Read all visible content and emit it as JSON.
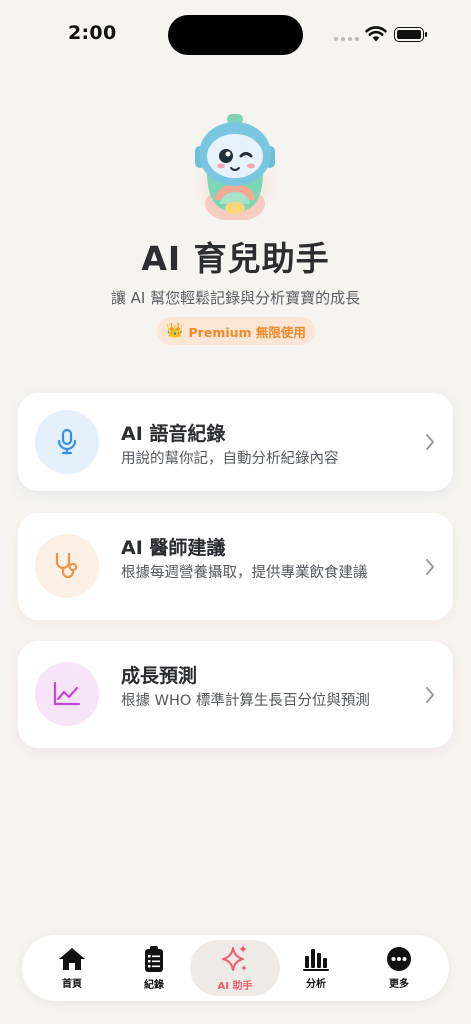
{
  "status_bar": {
    "time": "2:00"
  },
  "hero": {
    "title": "AI 育兒助手",
    "subtitle": "讓 AI 幫您輕鬆記錄與分析寶寶的成長",
    "badge_icon": "crown-icon",
    "badge_emoji": "👑",
    "badge_label": "Premium 無限使用"
  },
  "features": [
    {
      "title": "AI 語音紀錄",
      "description": "用說的幫你記，自動分析紀錄內容",
      "icon": "microphone-icon",
      "accent": "#3a8ee6"
    },
    {
      "title": "AI 醫師建議",
      "description": "根據每週營養攝取，提供專業飲食建議",
      "icon": "stethoscope-icon",
      "accent": "#ee9545"
    },
    {
      "title": "成長預測",
      "description": "根據 WHO 標準計算生長百分位與預測",
      "icon": "growth-chart-icon",
      "accent": "#c04bd0"
    }
  ],
  "tab_bar": {
    "items": [
      {
        "label": "首頁",
        "icon": "home-icon"
      },
      {
        "label": "紀錄",
        "icon": "clipboard-icon"
      },
      {
        "label": "AI 助手",
        "icon": "sparkles-icon",
        "active": true
      },
      {
        "label": "分析",
        "icon": "bar-chart-icon"
      },
      {
        "label": "更多",
        "icon": "more-icon"
      }
    ],
    "active_color": "#ec5d6e"
  }
}
